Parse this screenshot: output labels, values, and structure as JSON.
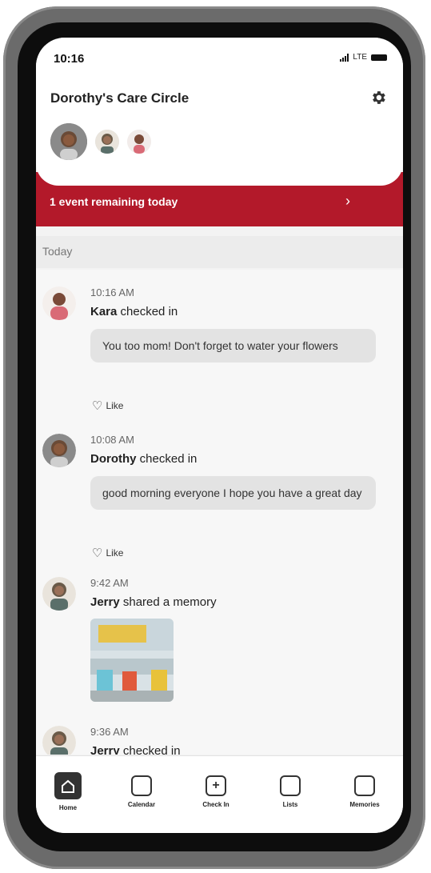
{
  "status_bar": {
    "time": "10:16",
    "network": "LTE"
  },
  "header": {
    "title": "Dorothy's Care Circle",
    "settings_icon": "gear-icon"
  },
  "banner": {
    "text": "1 event remaining today",
    "chevron": "›",
    "color": "#b3192a"
  },
  "section": {
    "label": "Today"
  },
  "feed": [
    {
      "time": "10:16 AM",
      "name": "Kara",
      "action": " checked in",
      "message": "You too mom! Don't forget to water your flowers",
      "like_label": "Like"
    },
    {
      "time": "10:08 AM",
      "name": "Dorothy",
      "action": " checked in",
      "message": "good morning everyone I hope you have a great day",
      "like_label": "Like"
    },
    {
      "time": "9:42 AM",
      "name": "Jerry",
      "action": " shared a memory"
    },
    {
      "time": "9:36 AM",
      "name": "Jerry",
      "action": " checked in"
    }
  ],
  "tabs": [
    {
      "label": "Home",
      "icon": "home-icon",
      "active": true
    },
    {
      "label": "Calendar",
      "icon": "calendar-icon"
    },
    {
      "label": "Check In",
      "icon": "check-in-icon"
    },
    {
      "label": "Lists",
      "icon": "lists-icon"
    },
    {
      "label": "Memories",
      "icon": "memories-icon"
    }
  ]
}
